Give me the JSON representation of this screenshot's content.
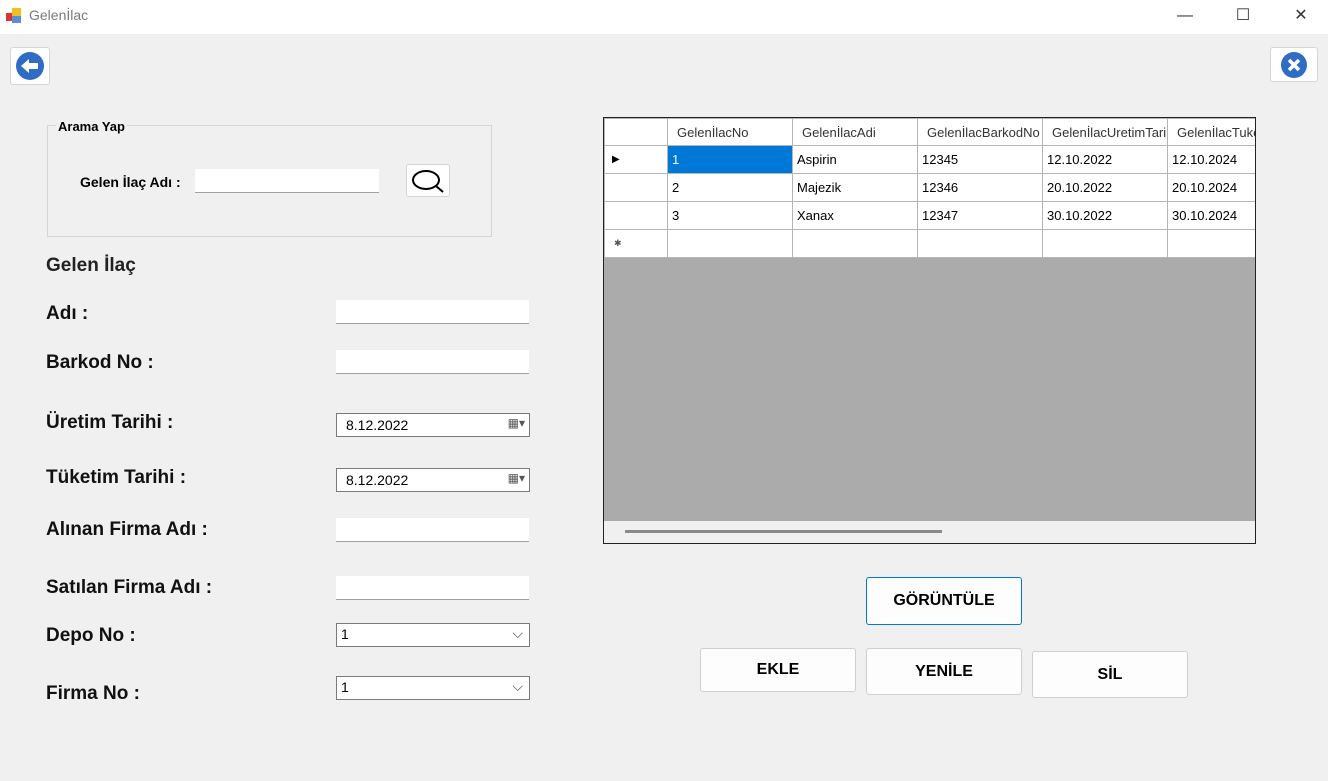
{
  "window": {
    "title": "Gelenİlac",
    "minimize": "—",
    "maximize": "☐",
    "close": "✕"
  },
  "search": {
    "group_label": "Arama Yap",
    "field_label": "Gelen İlaç Adı :",
    "value": ""
  },
  "form": {
    "section_title": "Gelen İlaç",
    "name_label": "Adı :",
    "name_value": "",
    "barcode_label": "Barkod No :",
    "barcode_value": "",
    "production_label": "Üretim Tarihi :",
    "production_value": "8.12.2022",
    "expiry_label": "Tüketim Tarihi :",
    "expiry_value": "8.12.2022",
    "buyer_label": "Alınan Firma Adı  :",
    "buyer_value": "",
    "seller_label": "Satılan Firma Adı  :",
    "seller_value": "",
    "depot_label": "Depo No  :",
    "depot_value": "1",
    "company_label": "Firma No  :",
    "company_value": "1"
  },
  "grid": {
    "columns": [
      "GelenİlacNo",
      "GelenİlacAdi",
      "GelenİlacBarkodNo",
      "GelenİlacUretimTarihi",
      "GelenİlacTuketimTarihi"
    ],
    "rows": [
      [
        "1",
        "Aspirin",
        "12345",
        "12.10.2022",
        "12.10.2024"
      ],
      [
        "2",
        "Majezik",
        "12346",
        "20.10.2022",
        "20.10.2024"
      ],
      [
        "3",
        "Xanax",
        "12347",
        "30.10.2022",
        "30.10.2024"
      ]
    ],
    "selection_color": "#0078d7"
  },
  "buttons": {
    "view": "GÖRÜNTÜLE",
    "add": "EKLE",
    "refresh": "YENİLE",
    "delete": "SİL"
  }
}
